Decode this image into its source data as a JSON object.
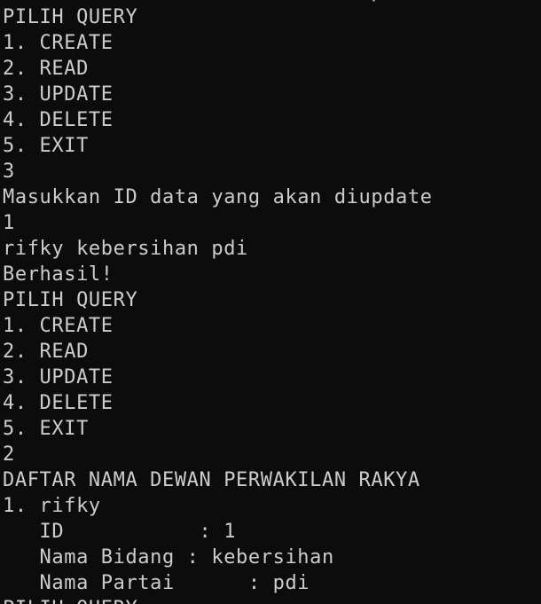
{
  "terminal": {
    "lines": [
      "                              p",
      "PILIH QUERY",
      "1. CREATE",
      "2. READ",
      "3. UPDATE",
      "4. DELETE",
      "5. EXIT",
      "3",
      "Masukkan ID data yang akan diupdate",
      "1",
      "rifky kebersihan pdi",
      "Berhasil!",
      "PILIH QUERY",
      "1. CREATE",
      "2. READ",
      "3. UPDATE",
      "4. DELETE",
      "5. EXIT",
      "2",
      "DAFTAR NAMA DEWAN PERWAKILAN RAKYA",
      "1. rifky",
      "   ID           : 1",
      "   Nama Bidang : kebersihan",
      "   Nama Partai      : pdi",
      "PILIH QUERY"
    ]
  },
  "colors": {
    "background": "#0c0c0c",
    "text": "#cccccc"
  }
}
